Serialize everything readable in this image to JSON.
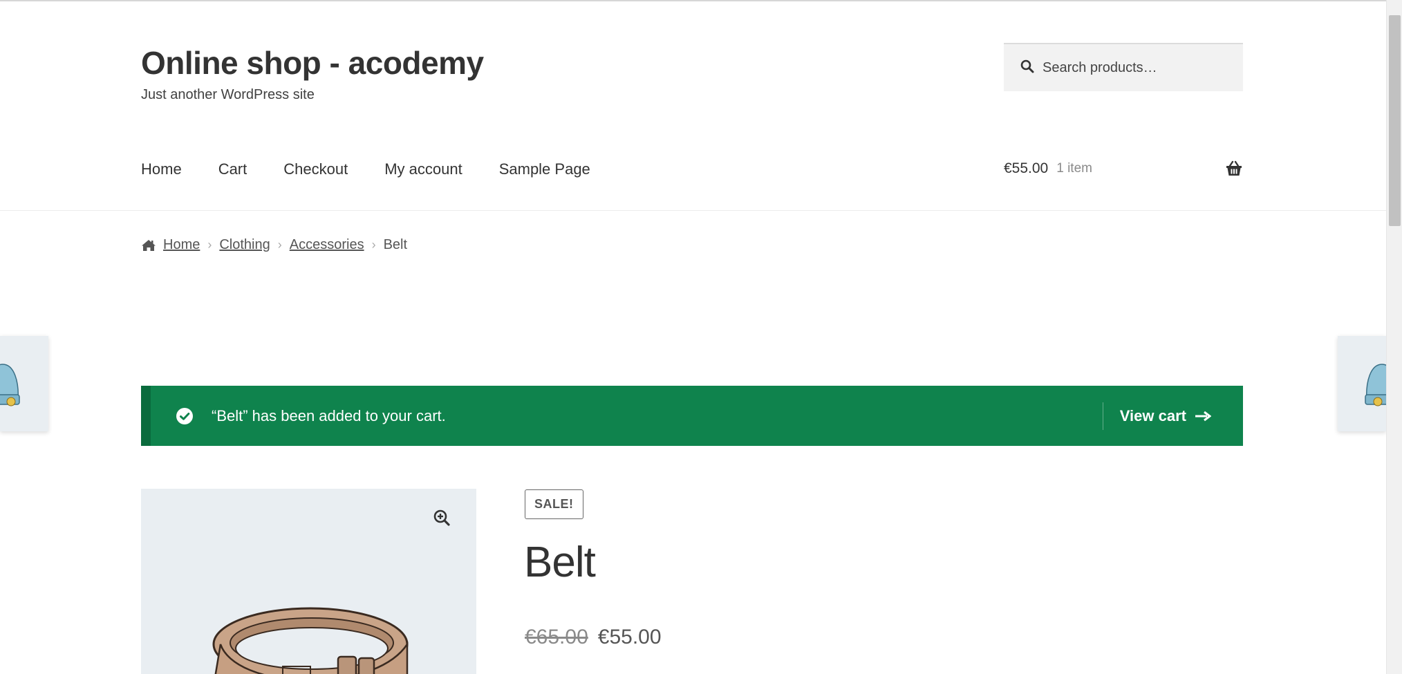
{
  "site": {
    "title": "Online shop - acodemy",
    "tagline": "Just another WordPress site"
  },
  "search": {
    "placeholder": "Search products…",
    "icon": "search-icon"
  },
  "nav": {
    "items": [
      "Home",
      "Cart",
      "Checkout",
      "My account",
      "Sample Page"
    ]
  },
  "mini_cart": {
    "amount": "€55.00",
    "count": "1 item",
    "icon": "basket-icon"
  },
  "breadcrumb": {
    "items": [
      "Home",
      "Clothing",
      "Accessories"
    ],
    "current": "Belt"
  },
  "notice": {
    "message": "“Belt” has been added to your cart.",
    "action": "View cart",
    "color": "#0f834d"
  },
  "product": {
    "badge": "SALE!",
    "title": "Belt",
    "regular_price": "€65.00",
    "sale_price": "€55.00"
  }
}
